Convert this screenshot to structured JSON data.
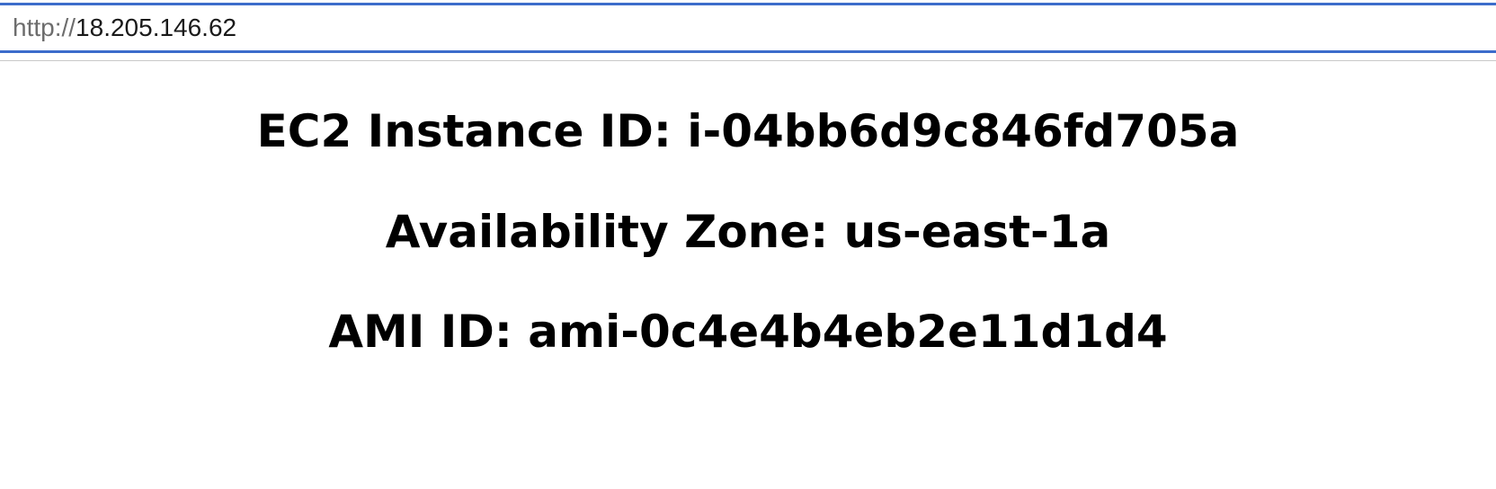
{
  "browser": {
    "address_bar": {
      "scheme": "http://",
      "host": "18.205.146.62"
    },
    "focus_color": "#3c6ccb"
  },
  "page": {
    "lines": [
      {
        "text": "EC2 Instance ID: i-04bb6d9c846fd705a"
      },
      {
        "text": "Availability Zone: us-east-1a"
      },
      {
        "text": "AMI ID: ami-0c4e4b4eb2e11d1d4"
      }
    ]
  }
}
